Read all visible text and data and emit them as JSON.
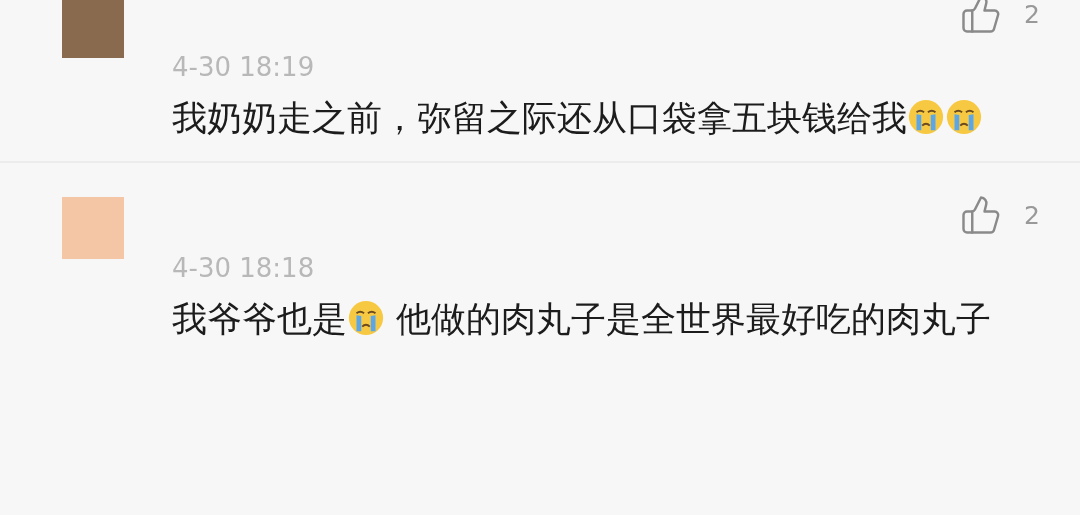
{
  "comments": [
    {
      "color": "#8a6a4e",
      "likes": "2",
      "time": "4-30 18:19",
      "content": [
        {
          "kind": "text",
          "text": "我奶奶走之前，弥留之际还从口袋拿五块钱给我"
        },
        {
          "kind": "emoji"
        },
        {
          "kind": "emoji"
        }
      ]
    },
    {
      "color": "#f5c6a5",
      "likes": "2",
      "time": "4-30 18:18",
      "content": [
        {
          "kind": "text",
          "text": "我爷爷也是"
        },
        {
          "kind": "emoji"
        },
        {
          "kind": "text",
          "text": " 他做的肉丸子是全世界最好吃的肉丸子"
        }
      ]
    }
  ]
}
